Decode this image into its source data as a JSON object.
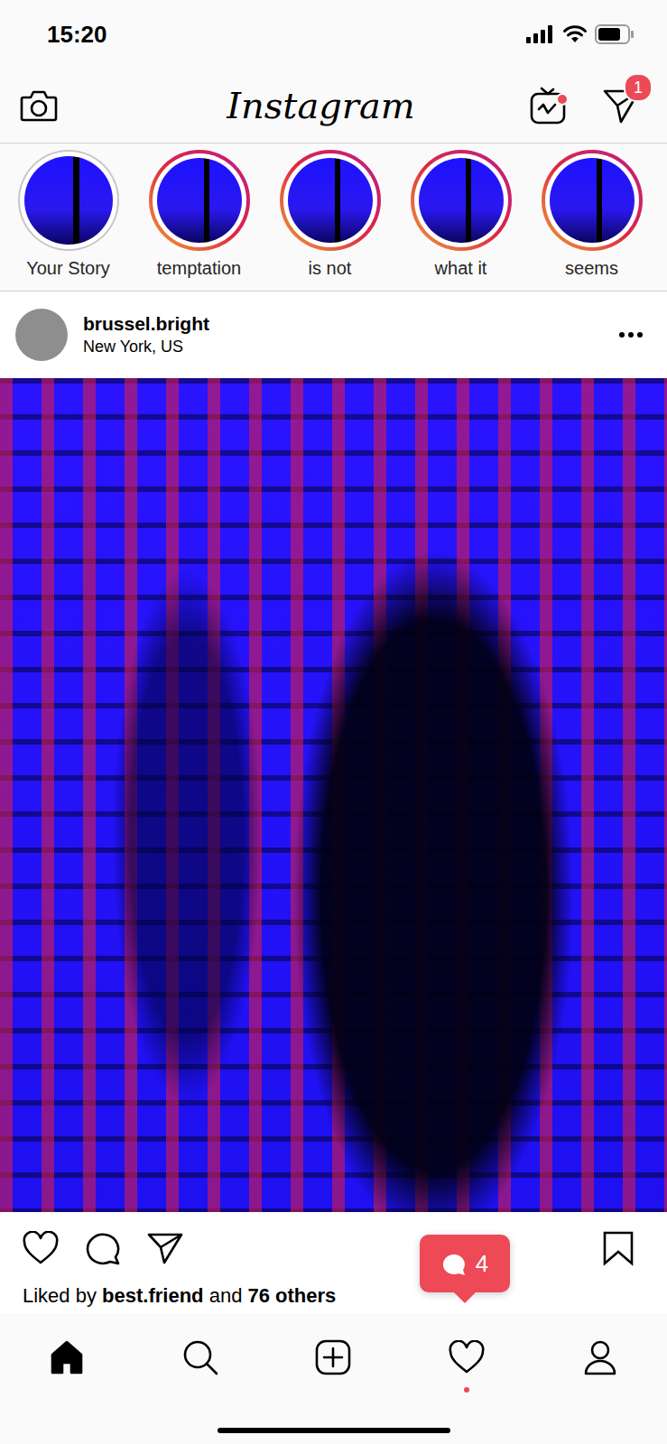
{
  "status_bar": {
    "time": "15:20"
  },
  "top_bar": {
    "logo": "Instagram",
    "igtv_has_new": true,
    "direct_badge": "1"
  },
  "stories": [
    {
      "label": "Your Story",
      "unseen": false
    },
    {
      "label": "temptation",
      "unseen": true
    },
    {
      "label": "is not",
      "unseen": true
    },
    {
      "label": "what it",
      "unseen": true
    },
    {
      "label": "seems",
      "unseen": true
    }
  ],
  "post": {
    "username": "brussel.bright",
    "location": "New York, US",
    "liked": false,
    "saved": false,
    "likes": {
      "prefix": "Liked by",
      "user": "best.friend",
      "middle": "and",
      "count": "76 others"
    }
  },
  "notification": {
    "count": "4"
  },
  "nav": [
    {
      "name": "home",
      "selected": true,
      "has_new": false
    },
    {
      "name": "search",
      "selected": false,
      "has_new": false
    },
    {
      "name": "add",
      "selected": false,
      "has_new": false
    },
    {
      "name": "activity",
      "selected": false,
      "has_new": true
    },
    {
      "name": "profile",
      "selected": false,
      "has_new": false
    }
  ]
}
